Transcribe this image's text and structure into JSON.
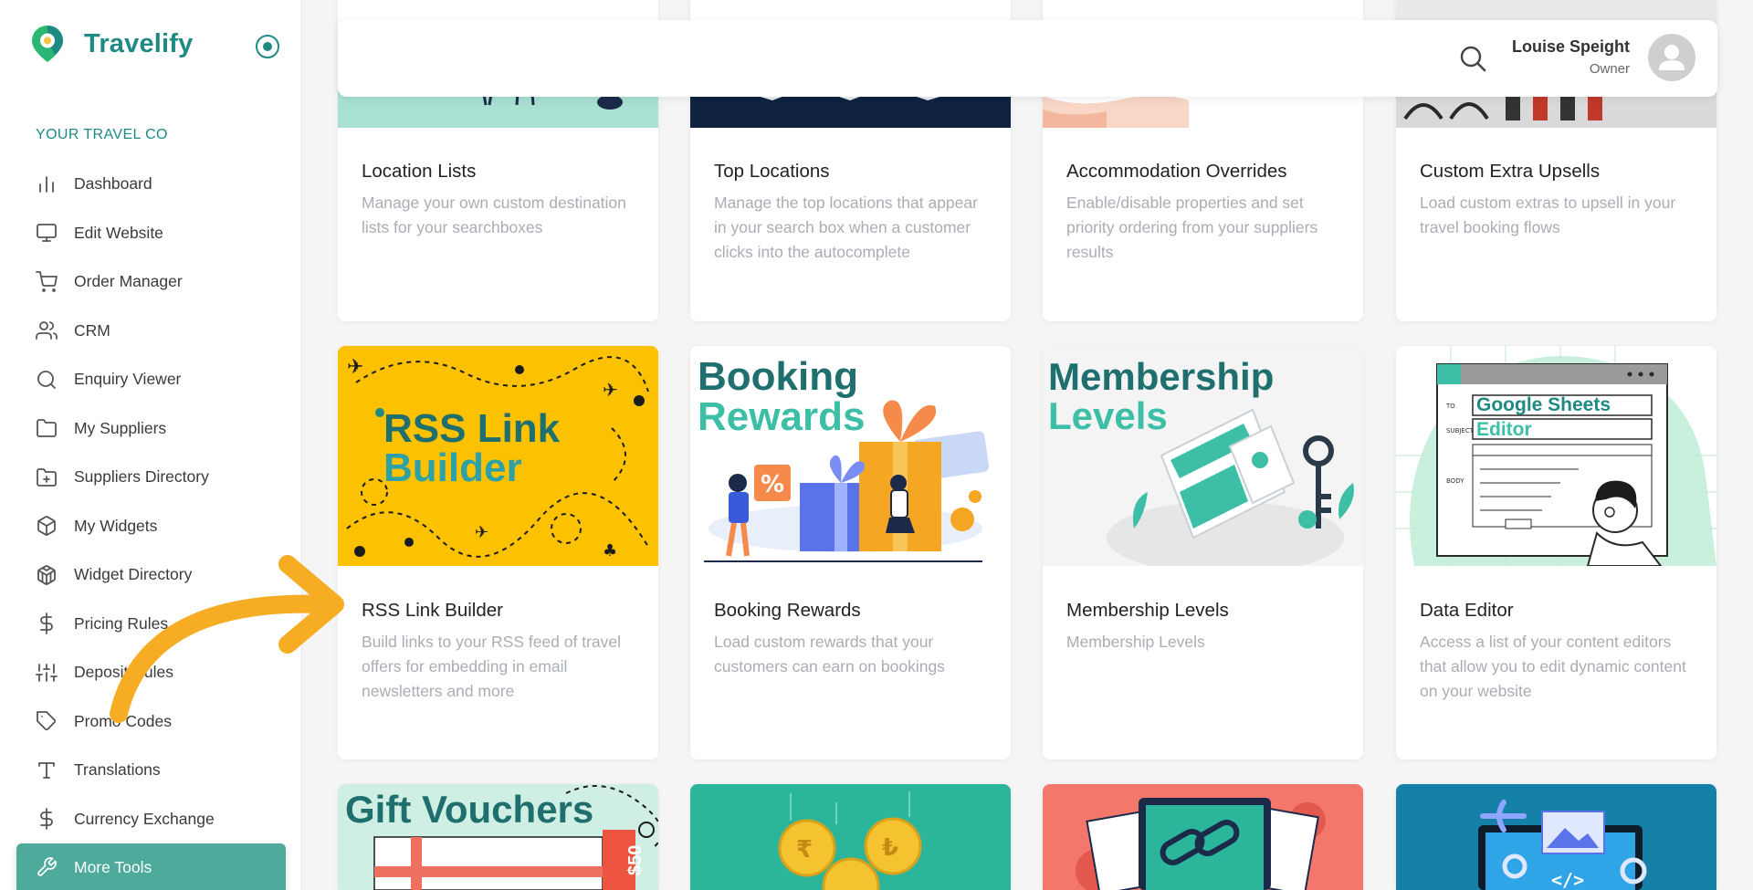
{
  "brand": {
    "name": "Travelify",
    "color": "#1f8a83"
  },
  "sidebar": {
    "section_title": "YOUR TRAVEL CO",
    "items": [
      {
        "label": "Dashboard",
        "icon": "bar-chart-icon"
      },
      {
        "label": "Edit Website",
        "icon": "monitor-icon"
      },
      {
        "label": "Order Manager",
        "icon": "cart-icon"
      },
      {
        "label": "CRM",
        "icon": "users-icon"
      },
      {
        "label": "Enquiry Viewer",
        "icon": "search-icon"
      },
      {
        "label": "My Suppliers",
        "icon": "folder-icon"
      },
      {
        "label": "Suppliers Directory",
        "icon": "folder-plus-icon"
      },
      {
        "label": "My Widgets",
        "icon": "box-icon"
      },
      {
        "label": "Widget Directory",
        "icon": "boxes-icon"
      },
      {
        "label": "Pricing Rules",
        "icon": "dollar-icon"
      },
      {
        "label": "Deposit Rules",
        "icon": "sliders-icon"
      },
      {
        "label": "Promo Codes",
        "icon": "tag-icon"
      },
      {
        "label": "Translations",
        "icon": "type-icon"
      },
      {
        "label": "Currency Exchange",
        "icon": "dollar-icon"
      },
      {
        "label": "More Tools",
        "icon": "wrench-icon",
        "active": true
      }
    ],
    "active_color": "#4eab9c"
  },
  "topbar": {
    "user_name": "Louise Speight",
    "user_role": "Owner"
  },
  "cards": {
    "row1": [
      {
        "title": "Location Lists",
        "desc": "Manage your own custom destination lists for your searchboxes"
      },
      {
        "title": "Top Locations",
        "desc": "Manage the top locations that appear in your search box when a customer clicks into the autocomplete"
      },
      {
        "title": "Accommodation Overrides",
        "desc": "Enable/disable properties and set priority ordering from your suppliers results"
      },
      {
        "title": "Custom Extra Upsells",
        "desc": "Load custom extras to upsell in your travel booking flows"
      }
    ],
    "row2": [
      {
        "title": "RSS Link Builder",
        "desc": "Build links to your RSS feed of travel offers for embedding in email newsletters and more",
        "img_line1": "RSS Link",
        "img_line2": "Builder"
      },
      {
        "title": "Booking Rewards",
        "desc": "Load custom rewards that your customers can earn on bookings",
        "img_line1": "Booking",
        "img_line2": "Rewards"
      },
      {
        "title": "Membership Levels",
        "desc": "Membership Levels",
        "img_line1": "Membership",
        "img_line2": "Levels"
      },
      {
        "title": "Data Editor",
        "desc": "Access a list of your content editors that allow you to edit dynamic content on your website",
        "img_line1": "Google Sheets",
        "img_line2": "Editor"
      }
    ],
    "row3": [
      {
        "img_line1": "Gift Vouchers",
        "img_tag": "$50"
      }
    ]
  },
  "colors": {
    "accent": "#1f8a83",
    "arrow": "#f6ac23",
    "rss_bg": "#fcc202"
  }
}
